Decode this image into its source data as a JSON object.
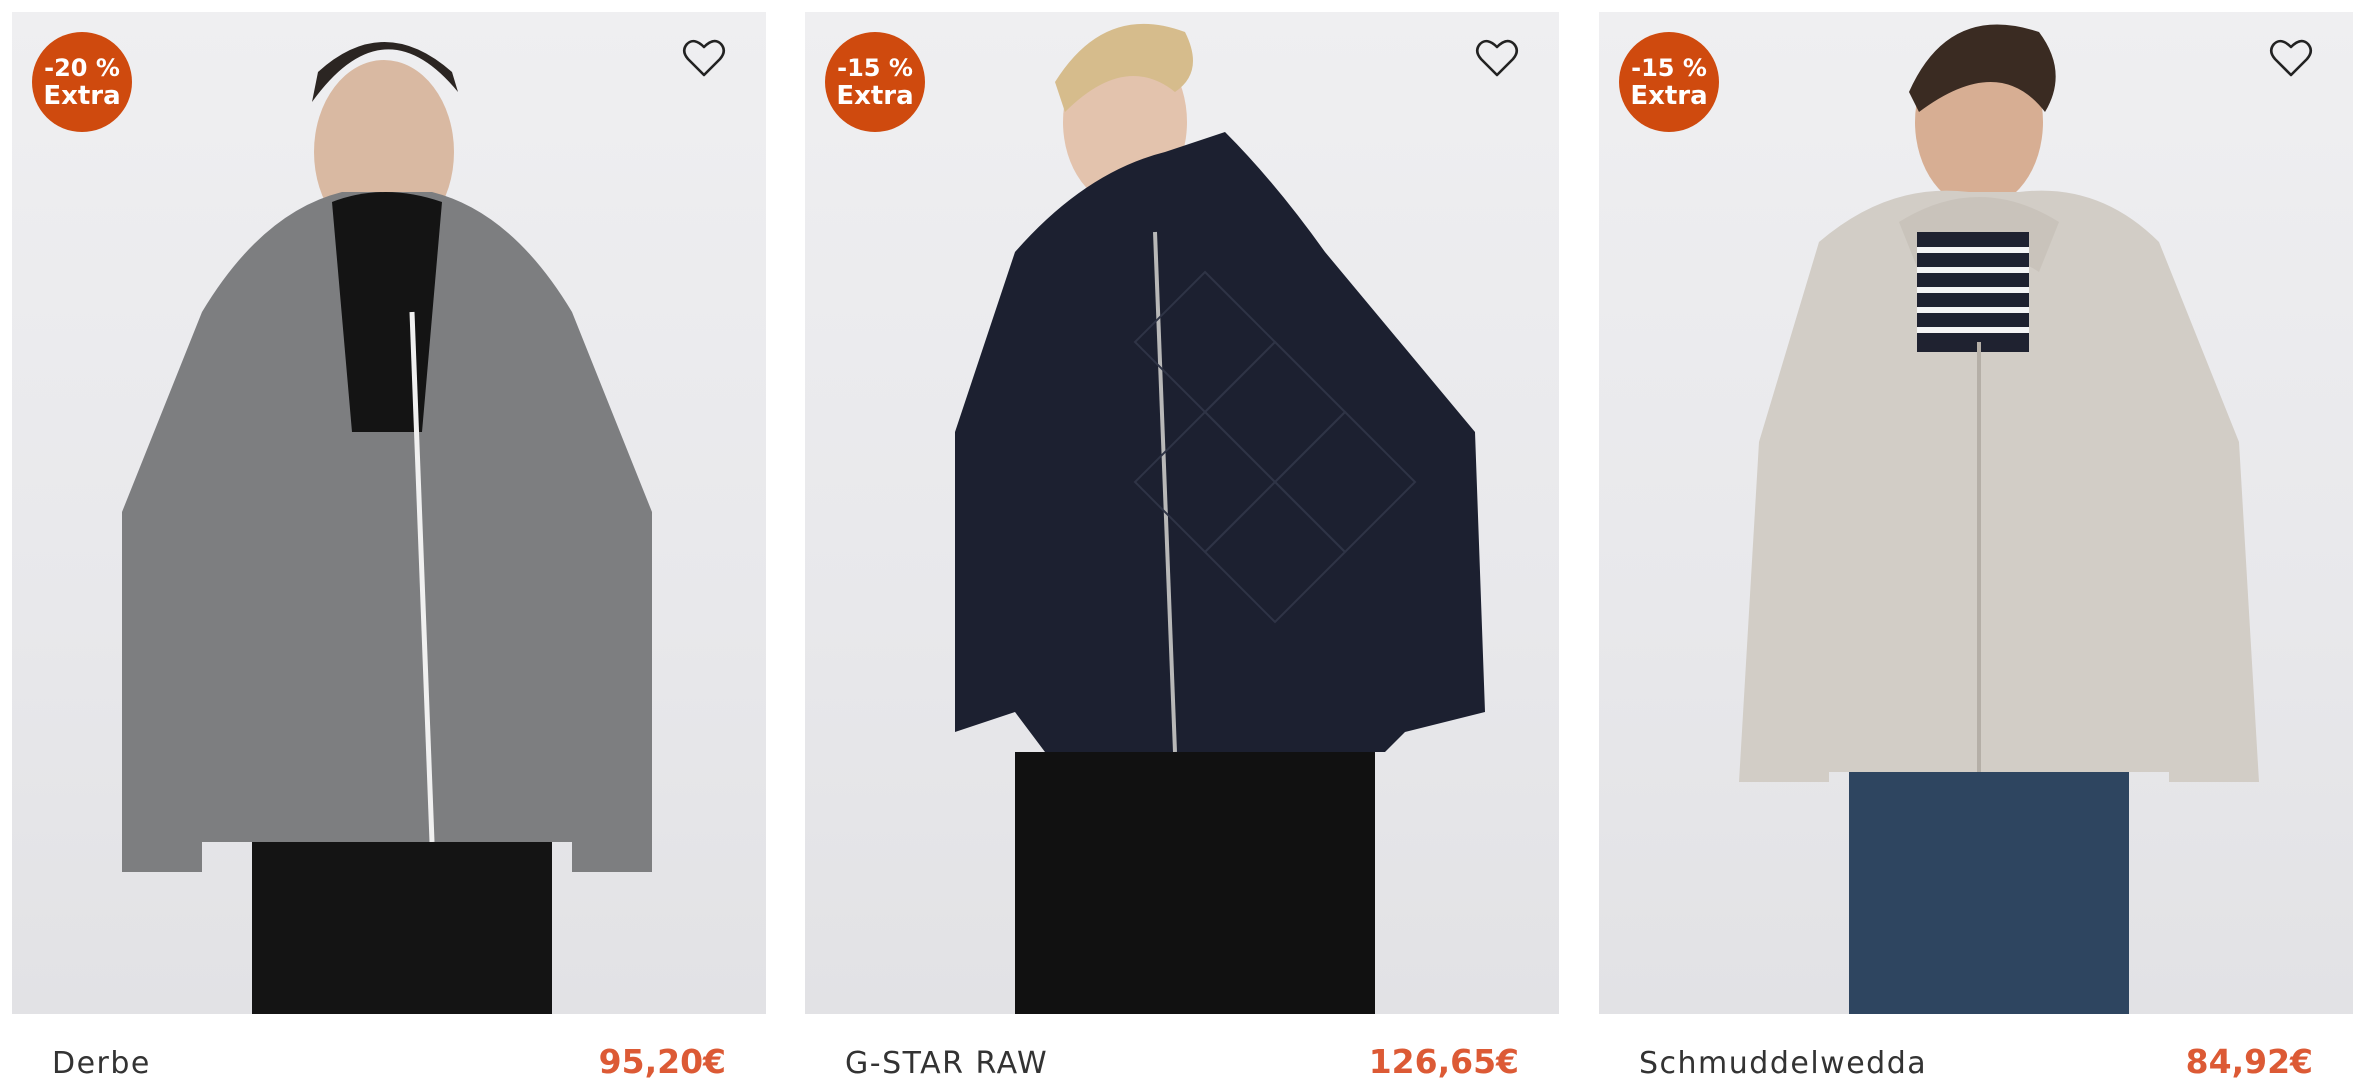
{
  "products": [
    {
      "badge_line1": "-20 %",
      "badge_line2": "Extra",
      "brand": "Derbe",
      "price": "95,20€",
      "jacket_color": "#7d7e80",
      "icons": {
        "favorite": "heart-outline-icon"
      }
    },
    {
      "badge_line1": "-15 %",
      "badge_line2": "Extra",
      "brand": "G-STAR RAW",
      "price": "126,65€",
      "jacket_color": "#1c2030",
      "icons": {
        "favorite": "heart-outline-icon"
      }
    },
    {
      "badge_line1": "-15 %",
      "badge_line2": "Extra",
      "brand": "Schmuddelwedda",
      "price": "84,92€",
      "jacket_color": "#d2cdc6",
      "icons": {
        "favorite": "heart-outline-icon"
      }
    }
  ],
  "colors": {
    "badge": "#cf4a0e",
    "price": "#dc5a35",
    "brand": "#333333"
  }
}
